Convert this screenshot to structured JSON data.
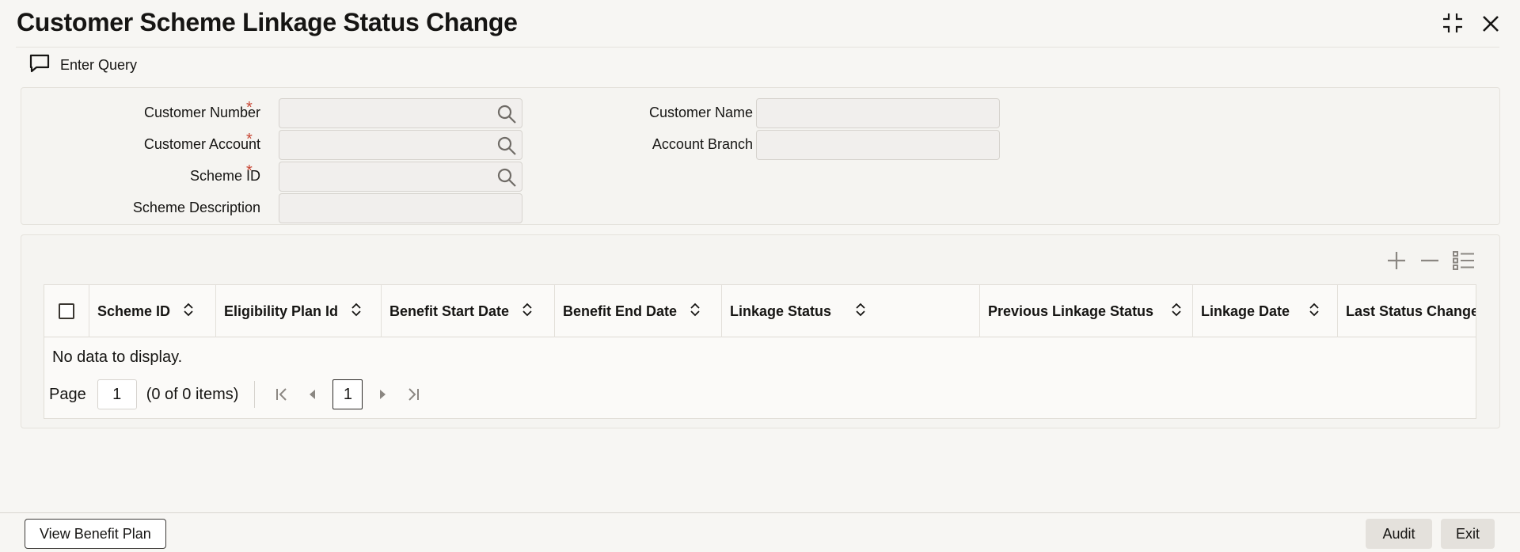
{
  "window": {
    "title": "Customer Scheme Linkage Status Change",
    "minimize_icon": "collapse-icon",
    "close_icon": "close-icon"
  },
  "toolbar": {
    "enter_query_label": "Enter Query",
    "enter_query_icon": "chat-bubble-icon"
  },
  "form": {
    "customer_number": {
      "label": "Customer Number",
      "required": "*",
      "value": ""
    },
    "customer_account": {
      "label": "Customer Account",
      "required": "*",
      "value": ""
    },
    "scheme_id": {
      "label": "Scheme ID",
      "required": "*",
      "value": ""
    },
    "scheme_description": {
      "label": "Scheme Description",
      "value": ""
    },
    "customer_name": {
      "label": "Customer Name",
      "value": ""
    },
    "account_branch": {
      "label": "Account Branch",
      "value": ""
    }
  },
  "grid": {
    "tools": [
      "add-icon",
      "remove-icon",
      "list-icon"
    ],
    "columns": [
      "Scheme ID",
      "Eligibility Plan Id",
      "Benefit Start Date",
      "Benefit End Date",
      "Linkage Status",
      "Previous Linkage Status",
      "Linkage Date",
      "Last Status Change I"
    ],
    "no_data": "No data to display.",
    "pager": {
      "page_label": "Page",
      "page_value": "1",
      "count": "(0 of 0 items)",
      "current": "1"
    }
  },
  "footer": {
    "view_benefit_plan": "View Benefit Plan",
    "audit": "Audit",
    "exit": "Exit"
  },
  "colors": {
    "required": "#c74634",
    "background": "#f7f6f3",
    "panel": "#f5f4f1"
  }
}
